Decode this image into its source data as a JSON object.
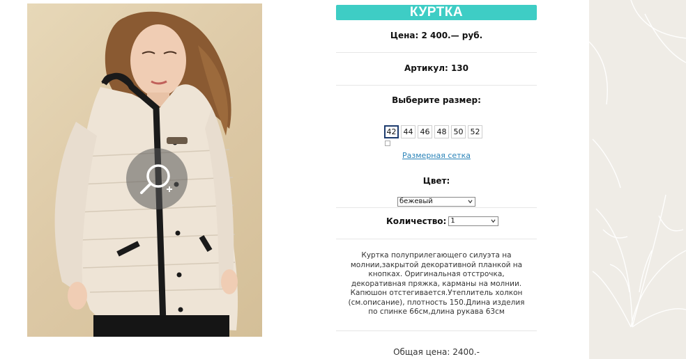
{
  "product": {
    "title": "КУРТКА",
    "price": "Цена: 2 400.— руб.",
    "article": "Артикул: 130",
    "choose_size_label": "Выберите размер:",
    "sizes": [
      "42",
      "44",
      "46",
      "48",
      "50",
      "52"
    ],
    "selected_size": "42",
    "size_chart_link": "Размерная сетка",
    "color_label": "Цвет:",
    "color_value": "бежевый",
    "quantity_label": "Количество:",
    "quantity_value": "1",
    "description": "Куртка полуприлегающего силуэта на молнии,закрытой декоративной планкой на кнопках. Оригинальная отстрочка, декоративная пряжка, карманы на молнии. Капюшон отстегивается.Утеплитель холкон (см.описание), плотность 150.Длина изделия по спинке 66см,длина рукава 63см",
    "total": "Общая цена: 2400.-"
  },
  "colors": {
    "accent": "#3ecdc5",
    "link": "#2a83b8",
    "deco_bg": "#efece6"
  },
  "icons": {
    "zoom": "zoom-in-magnifier-icon"
  }
}
